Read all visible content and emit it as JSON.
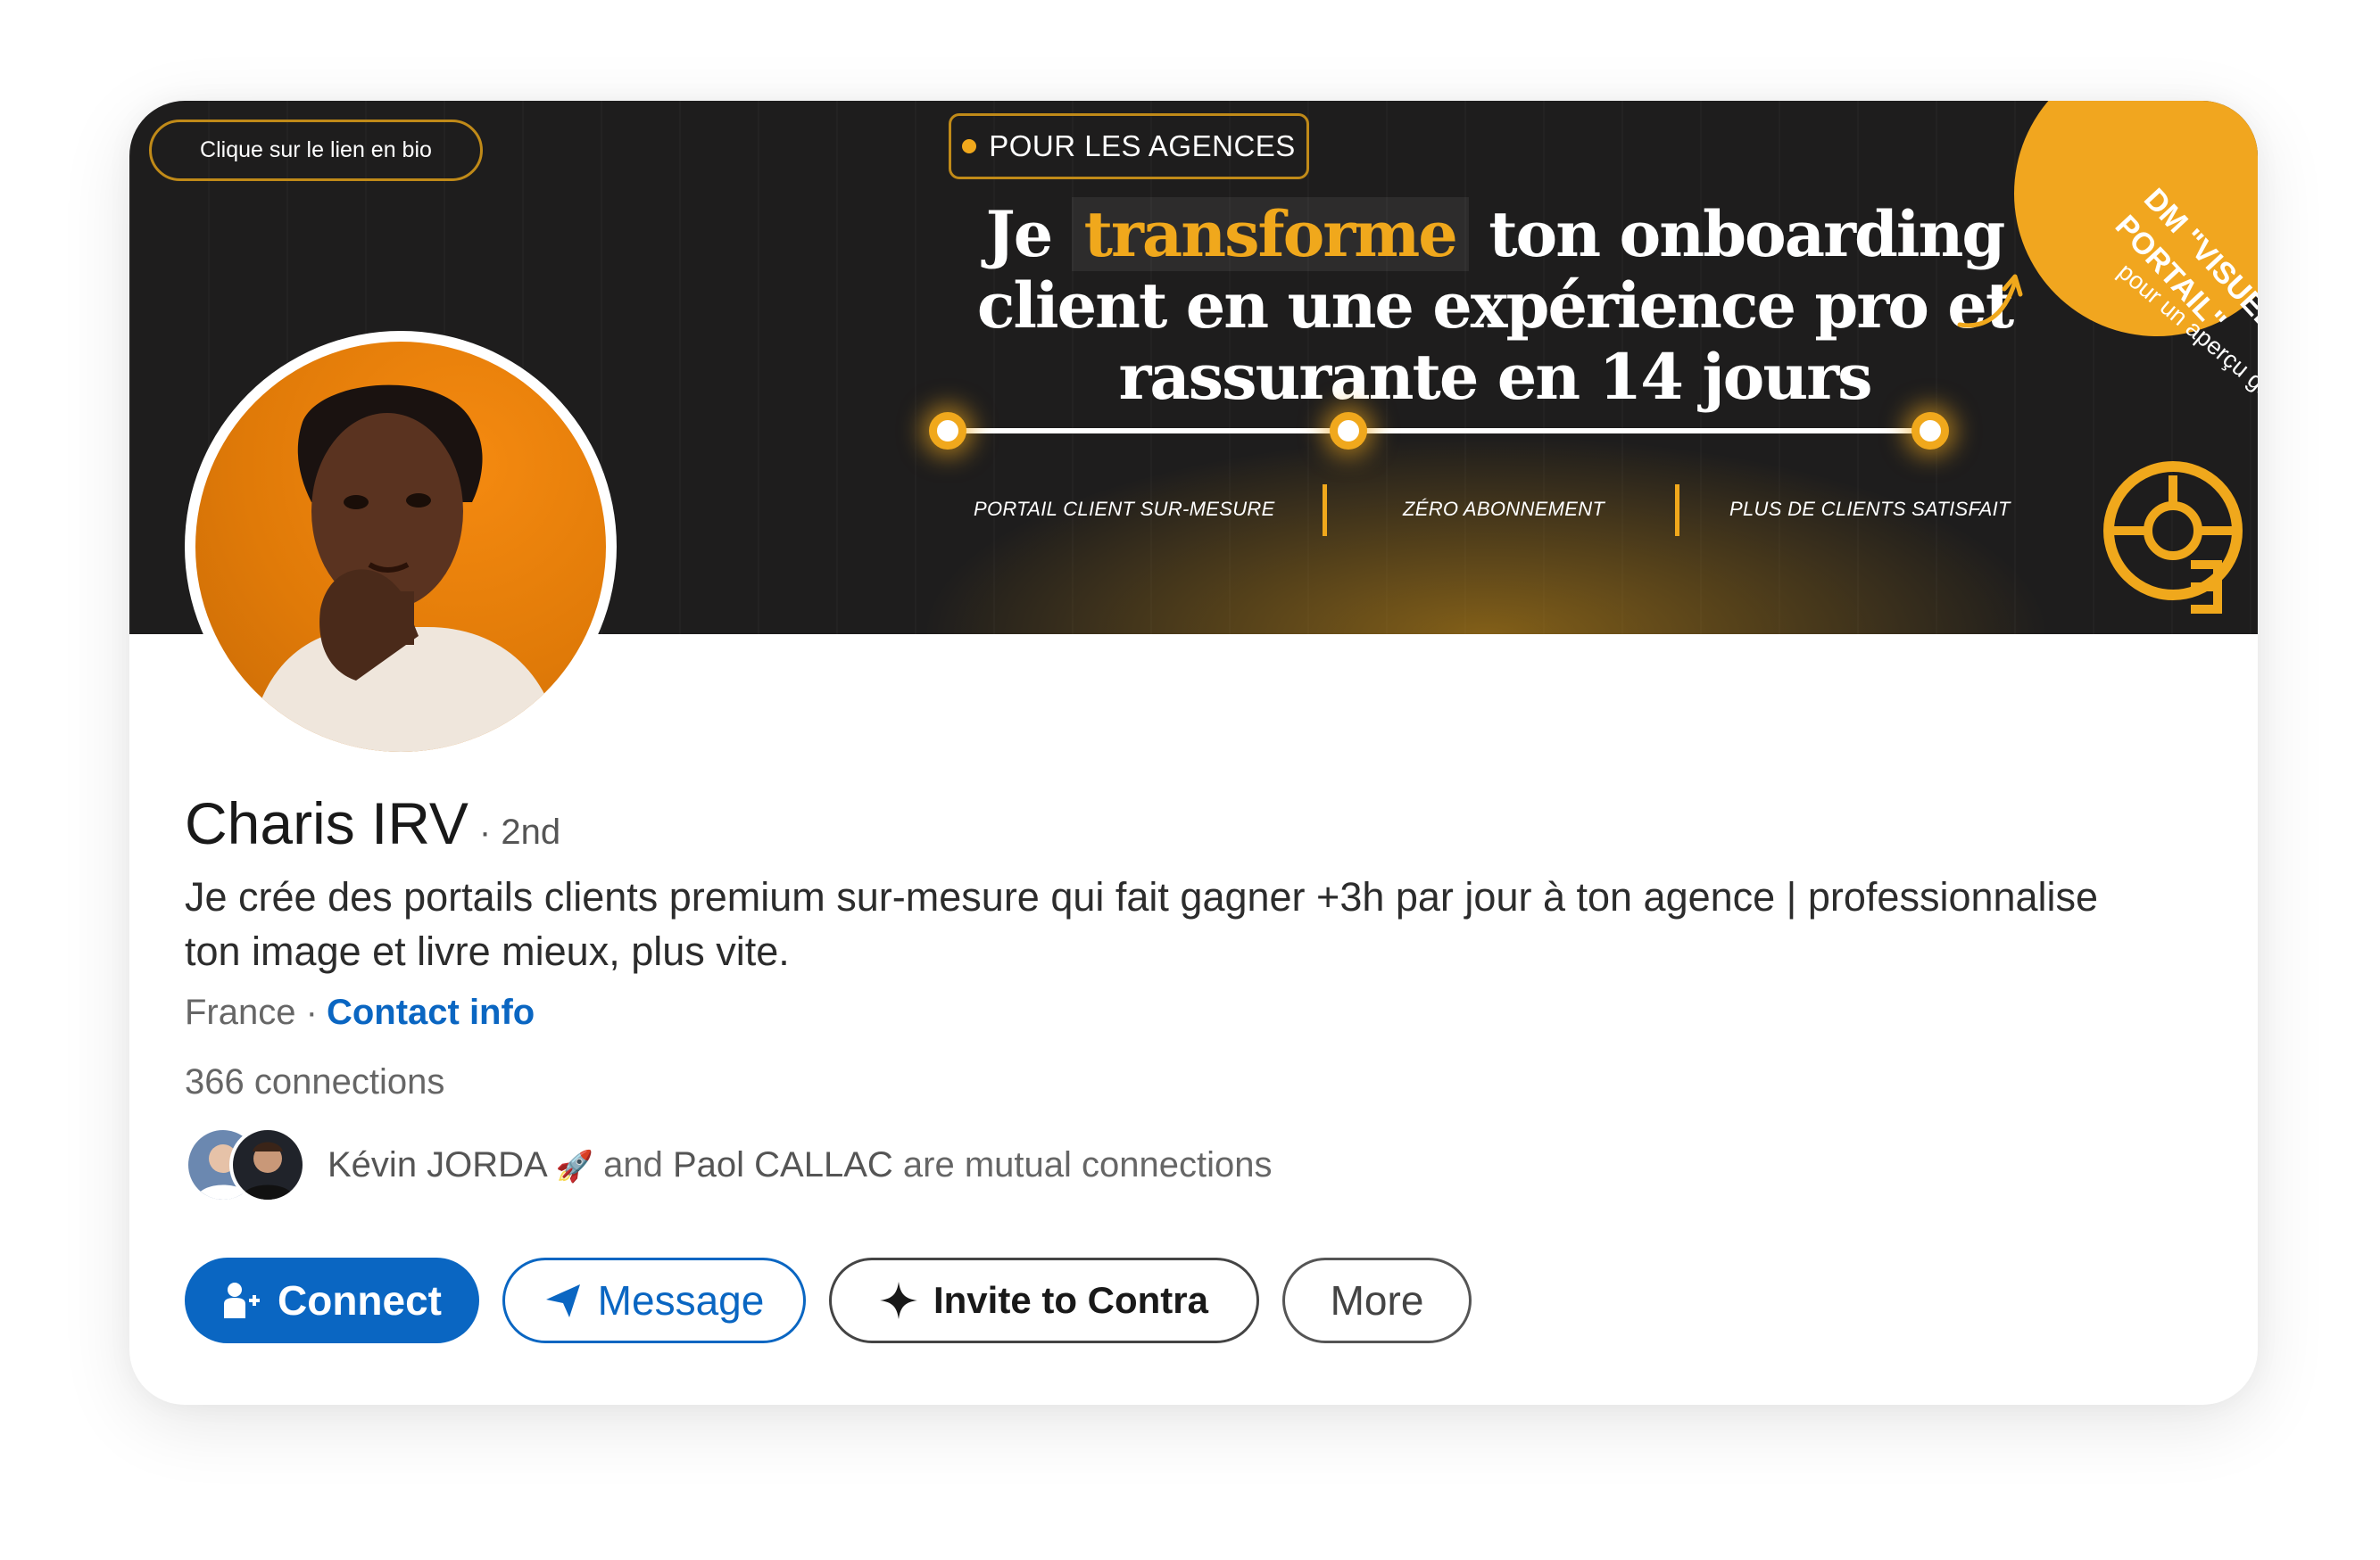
{
  "banner": {
    "bio_pill": "Clique sur le lien en bio",
    "agences_pill": "POUR LES AGENCES",
    "headline_pre": "Je ",
    "headline_highlight": "transforme",
    "headline_line1_post": " ton onboarding",
    "headline_line2": "client en une expérience pro et",
    "headline_line3": "rassurante en 14 jours",
    "steps": [
      "PORTAIL CLIENT SUR-MESURE",
      "ZÉRO ABONNEMENT",
      "PLUS DE CLIENTS SATISFAIT"
    ],
    "badge_main": "DM \"VISUEL PORTAIL\"",
    "badge_sub": "pour un aperçu gratuit",
    "accent_color": "#f0a81c"
  },
  "profile": {
    "name": "Charis IRV",
    "degree": "· 2nd",
    "headline": "Je crée des portails clients premium sur-mesure qui fait gagner +3h par jour à ton agence | professionnalise ton image et livre mieux, plus vite.",
    "location": "France ·",
    "contact_info": "Contact info",
    "connections": "366 connections",
    "mutual": {
      "person1": "Kévin JORDA",
      "person1_emoji": "🚀",
      "and": "and",
      "person2": "Paol CALLAC",
      "suffix": "are mutual connections"
    }
  },
  "actions": {
    "connect": "Connect",
    "message": "Message",
    "invite": "Invite to Contra",
    "more": "More"
  },
  "colors": {
    "linkedin_blue": "#0a66c2",
    "banner_bg": "#1e1d1d",
    "avatar_bg": "#f58a10"
  }
}
